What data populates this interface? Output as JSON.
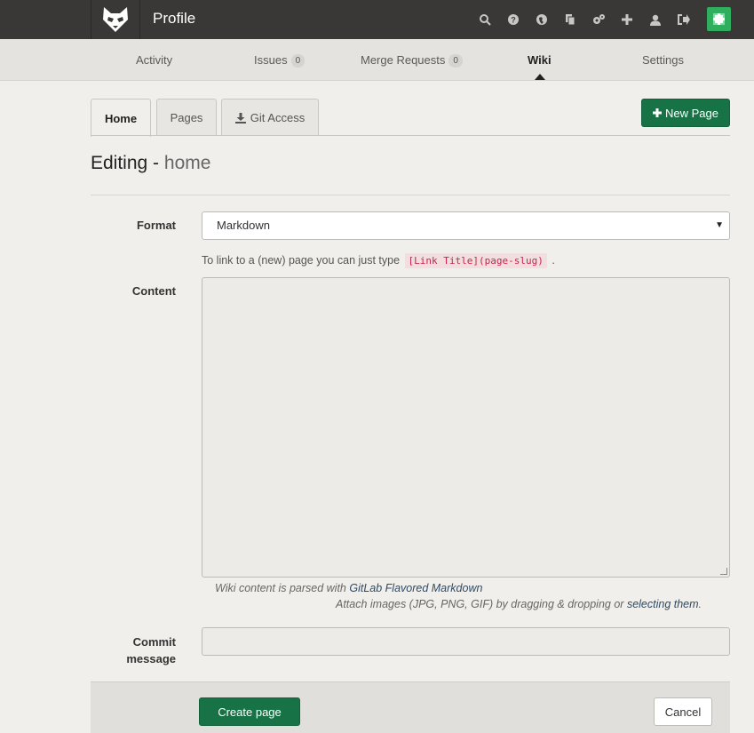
{
  "header": {
    "title": "Profile",
    "icons": [
      "search-icon",
      "help-icon",
      "globe-icon",
      "copy-icon",
      "settings-icon",
      "plus-icon",
      "user-icon",
      "sign-out-icon"
    ]
  },
  "subnav": {
    "activity": "Activity",
    "issues": "Issues",
    "issues_count": "0",
    "merge_requests": "Merge Requests",
    "merge_requests_count": "0",
    "wiki": "Wiki",
    "settings": "Settings"
  },
  "tabs": {
    "home": "Home",
    "pages": "Pages",
    "git_access": "Git Access"
  },
  "new_page_label": "New Page",
  "heading": {
    "prefix": "Editing -",
    "page": "home"
  },
  "form": {
    "format_label": "Format",
    "format_value": "Markdown",
    "hint_text": "To link to a (new) page you can just type",
    "hint_code": "[Link Title](page-slug)",
    "hint_end": ".",
    "content_label": "Content",
    "help_prefix": "Wiki content is parsed with",
    "help_link": "GitLab Flavored Markdown",
    "attach_text": "Attach images (JPG, PNG, GIF) by dragging & dropping or",
    "attach_link": "selecting them",
    "attach_end": ".",
    "commit_label_line1": "Commit",
    "commit_label_line2": "message"
  },
  "actions": {
    "create": "Create page",
    "cancel": "Cancel"
  },
  "colors": {
    "topbar": "#3a3836",
    "accent_green": "#177245"
  }
}
